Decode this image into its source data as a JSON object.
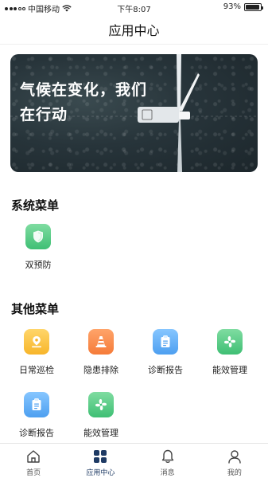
{
  "status_bar": {
    "carrier": "中国移动",
    "time": "下午8:07",
    "battery": "93%",
    "battery_level": 0.93
  },
  "header": {
    "title": "应用中心"
  },
  "banner": {
    "line1": "气候在变化，我们",
    "line2": "在行动"
  },
  "system_menu": {
    "title": "系统菜单",
    "items": [
      {
        "label": "双预防",
        "icon": "shield-icon",
        "color": "#4cc47e"
      }
    ]
  },
  "other_menu": {
    "title": "其他菜单",
    "items": [
      {
        "label": "日常巡检",
        "icon": "location-pin-icon",
        "color": "#f7b52a"
      },
      {
        "label": "隐患排除",
        "icon": "traffic-cone-icon",
        "color": "#f57b39"
      },
      {
        "label": "诊断报告",
        "icon": "clipboard-icon",
        "color": "#4d9ff0"
      },
      {
        "label": "能效管理",
        "icon": "fan-icon",
        "color": "#3fbf74"
      },
      {
        "label": "诊断报告",
        "icon": "clipboard-icon",
        "color": "#4d9ff0"
      },
      {
        "label": "能效管理",
        "icon": "fan-icon",
        "color": "#3fbf74"
      }
    ]
  },
  "tab_bar": {
    "items": [
      {
        "label": "首页",
        "icon": "home-icon"
      },
      {
        "label": "应用中心",
        "icon": "grid-icon",
        "active": true
      },
      {
        "label": "消息",
        "icon": "bell-icon"
      },
      {
        "label": "我的",
        "icon": "user-icon"
      }
    ],
    "active_color": "#1e3a64"
  }
}
